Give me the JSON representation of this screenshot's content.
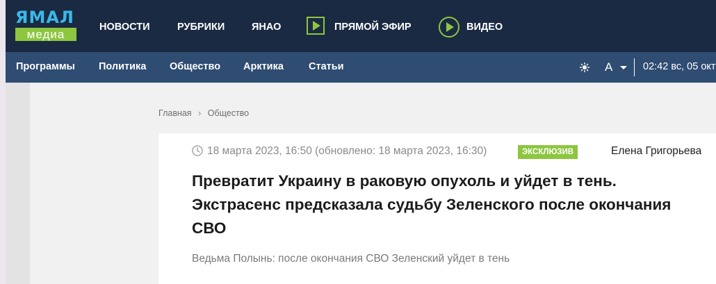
{
  "brand": {
    "logo_top": "ЯМАЛ",
    "logo_bottom": "медиа",
    "colors": {
      "dark_nav": "#1b2a43",
      "sub_nav": "#2f4c72",
      "accent_green": "#8dc63f",
      "accent_blue": "#39b9e8"
    }
  },
  "main_nav": {
    "items": [
      {
        "label": "НОВОСТИ"
      },
      {
        "label": "РУБРИКИ"
      },
      {
        "label": "ЯНАО"
      },
      {
        "label": "ПРЯМОЙ ЭФИР",
        "icon": "play-square-icon"
      },
      {
        "label": "ВИДЕО",
        "icon": "play-circle-icon"
      }
    ]
  },
  "sub_nav": {
    "items": [
      {
        "label": "Программы"
      },
      {
        "label": "Политика"
      },
      {
        "label": "Общество"
      },
      {
        "label": "Арктика"
      },
      {
        "label": "Статьи"
      }
    ],
    "theme_icon": "sun-icon",
    "font_size_label": "А",
    "datetime": "02:42 вс, 05 окт"
  },
  "breadcrumb": {
    "home": "Главная",
    "current": "Общество"
  },
  "article": {
    "date_icon": "clock-icon",
    "date": "18 марта 2023, 16:50 (обновлено: 18 марта 2023, 16:30)",
    "badge": "эксклюзив",
    "author": "Елена Григорьева",
    "headline": "Превратит Украину в раковую опухоль и уйдет в тень. Экстрасенс предсказала судьбу Зеленского после окончания СВО",
    "lead": "Ведьма Полынь: после окончания СВО Зеленский уйдет в тень"
  }
}
